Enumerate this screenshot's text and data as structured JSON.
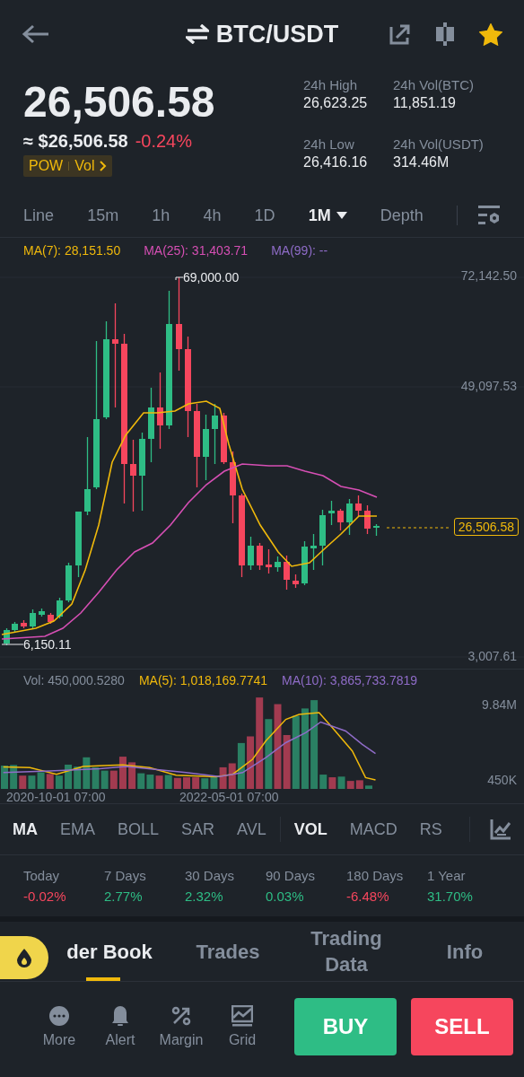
{
  "header": {
    "title": "BTC/USDT",
    "favorite": true
  },
  "price": {
    "last": "26,506.58",
    "fiat": "≈ $26,506.58",
    "change": "-0.24%",
    "tags": [
      "POW",
      "Vol"
    ]
  },
  "stats": [
    {
      "label": "24h High",
      "value": "26,623.25"
    },
    {
      "label": "24h Vol(BTC)",
      "value": "11,851.19"
    },
    {
      "label": "24h Low",
      "value": "26,416.16"
    },
    {
      "label": "24h Vol(USDT)",
      "value": "314.46M"
    }
  ],
  "intervals": [
    {
      "label": "Line",
      "selected": false,
      "kind": "plain"
    },
    {
      "label": "15m",
      "selected": false,
      "kind": "plain"
    },
    {
      "label": "1h",
      "selected": false,
      "kind": "plain"
    },
    {
      "label": "4h",
      "selected": false,
      "kind": "plain"
    },
    {
      "label": "1D",
      "selected": false,
      "kind": "plain"
    },
    {
      "label": "1M",
      "selected": true,
      "kind": "dropdown"
    },
    {
      "label": "Depth",
      "selected": false,
      "kind": "plain"
    }
  ],
  "chart": {
    "ma_legend": [
      {
        "label": "MA(7): 28,151.50",
        "color": "#f0b90b"
      },
      {
        "label": "MA(25): 31,403.71",
        "color": "#d64fb4"
      },
      {
        "label": "MA(99): --",
        "color": "#8f6cc8"
      }
    ],
    "price_ticks": [
      "72,142.50",
      "49,097.53",
      "3,007.61"
    ],
    "high_marker": "69,000.00",
    "low_marker": "6,150.11",
    "current_price": "26,506.58"
  },
  "volume": {
    "legend": [
      {
        "label": "Vol: 450,000.5280",
        "color": "#848e9c"
      },
      {
        "label": "MA(5): 1,018,169.7741",
        "color": "#f0b90b"
      },
      {
        "label": "MA(10): 3,865,733.7819",
        "color": "#8f6cc8"
      }
    ],
    "ticks": [
      "9.84M",
      "450K"
    ],
    "dates": [
      "2020-10-01 07:00",
      "2022-05-01 07:00"
    ]
  },
  "indicators": {
    "main": [
      {
        "label": "MA",
        "selected": true
      },
      {
        "label": "EMA",
        "selected": false
      },
      {
        "label": "BOLL",
        "selected": false
      },
      {
        "label": "SAR",
        "selected": false
      },
      {
        "label": "AVL",
        "selected": false
      }
    ],
    "sub": [
      {
        "label": "VOL",
        "selected": true
      },
      {
        "label": "MACD",
        "selected": false
      },
      {
        "label": "RS",
        "selected": false
      }
    ]
  },
  "performance": [
    {
      "label": "Today",
      "value": "-0.02%",
      "color": "#f6465d"
    },
    {
      "label": "7 Days",
      "value": "2.77%",
      "color": "#2ebd85"
    },
    {
      "label": "30 Days",
      "value": "2.32%",
      "color": "#2ebd85"
    },
    {
      "label": "90 Days",
      "value": "0.03%",
      "color": "#2ebd85"
    },
    {
      "label": "180 Days",
      "value": "-6.48%",
      "color": "#f6465d"
    },
    {
      "label": "1 Year",
      "value": "31.70%",
      "color": "#2ebd85"
    }
  ],
  "bottom_tabs": [
    {
      "label": "der Book",
      "selected": true
    },
    {
      "label": "Trades",
      "selected": false
    },
    {
      "label": "Trading Data",
      "selected": false
    },
    {
      "label": "Info",
      "selected": false
    }
  ],
  "actions": [
    {
      "label": "More",
      "kind": "more"
    },
    {
      "label": "Alert",
      "kind": "alert"
    },
    {
      "label": "Margin",
      "kind": "margin"
    },
    {
      "label": "Grid",
      "kind": "grid"
    }
  ],
  "buy": "BUY",
  "sell": "SELL"
}
